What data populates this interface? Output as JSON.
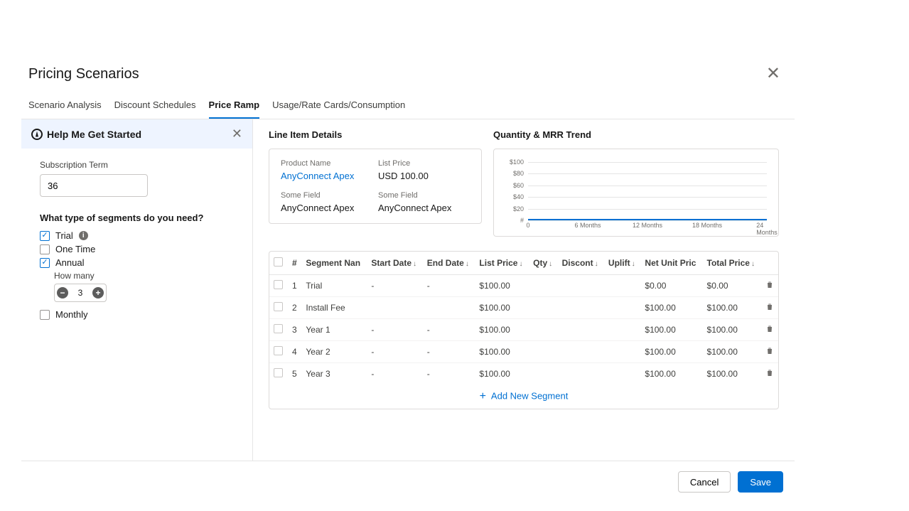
{
  "modal": {
    "title": "Pricing Scenarios",
    "tabs": [
      "Scenario Analysis",
      "Discount Schedules",
      "Price Ramp",
      "Usage/Rate Cards/Consumption"
    ],
    "activeTab": 2
  },
  "sidebar": {
    "helpTitle": "Help Me Get Started",
    "termLabel": "Subscription Term",
    "termValue": "36",
    "question": "What type of segments do you need?",
    "options": {
      "trial": {
        "label": "Trial",
        "checked": true,
        "hasInfo": true
      },
      "oneTime": {
        "label": "One Time",
        "checked": false
      },
      "annual": {
        "label": "Annual",
        "checked": true,
        "howManyLabel": "How many",
        "howManyValue": "3"
      },
      "monthly": {
        "label": "Monthly",
        "checked": false
      }
    }
  },
  "lineItem": {
    "title": "Line Item Details",
    "fields": [
      {
        "label": "Product Name",
        "value": "AnyConnect Apex",
        "link": true
      },
      {
        "label": "List Price",
        "value": "USD 100.00"
      },
      {
        "label": "Some Field",
        "value": "AnyConnect Apex"
      },
      {
        "label": "Some Field",
        "value": "AnyConnect Apex"
      }
    ]
  },
  "chart": {
    "title": "Quantity & MRR Trend",
    "ylabels": [
      "$100",
      "$80",
      "$60",
      "$40",
      "$20",
      "#"
    ],
    "xlabels": [
      "0",
      "6 Months",
      "12 Months",
      "18 Months",
      "24 Months"
    ]
  },
  "chart_data": {
    "type": "line",
    "title": "Quantity & MRR Trend",
    "x": [
      0,
      6,
      12,
      18,
      24
    ],
    "xlabel": "Months",
    "ylabel": "$",
    "ylim": [
      0,
      100
    ],
    "series": [
      {
        "name": "MRR",
        "values": [
          0,
          0,
          0,
          0,
          0
        ]
      }
    ]
  },
  "table": {
    "headers": [
      "#",
      "Segment Nan",
      "Start Date",
      "End Date",
      "List Price",
      "Qty",
      "Discont",
      "Uplift",
      "Net Unit Pric",
      "Total Price"
    ],
    "sortable": [
      false,
      false,
      true,
      true,
      true,
      true,
      true,
      true,
      false,
      true
    ],
    "rows": [
      {
        "num": "1",
        "name": "Trial",
        "start": "-",
        "end": "-",
        "list": "$100.00",
        "qty": "",
        "disc": "",
        "uplift": "",
        "net": "$0.00",
        "total": "$0.00"
      },
      {
        "num": "2",
        "name": "Install Fee",
        "start": "",
        "end": "",
        "list": "$100.00",
        "qty": "",
        "disc": "",
        "uplift": "",
        "net": "$100.00",
        "total": "$100.00"
      },
      {
        "num": "3",
        "name": "Year 1",
        "start": "-",
        "end": "-",
        "list": "$100.00",
        "qty": "",
        "disc": "",
        "uplift": "",
        "net": "$100.00",
        "total": "$100.00"
      },
      {
        "num": "4",
        "name": "Year 2",
        "start": "-",
        "end": "-",
        "list": "$100.00",
        "qty": "",
        "disc": "",
        "uplift": "",
        "net": "$100.00",
        "total": "$100.00"
      },
      {
        "num": "5",
        "name": "Year 3",
        "start": "-",
        "end": "-",
        "list": "$100.00",
        "qty": "",
        "disc": "",
        "uplift": "",
        "net": "$100.00",
        "total": "$100.00"
      }
    ],
    "addLabel": "Add New Segment"
  },
  "footer": {
    "cancel": "Cancel",
    "save": "Save"
  }
}
